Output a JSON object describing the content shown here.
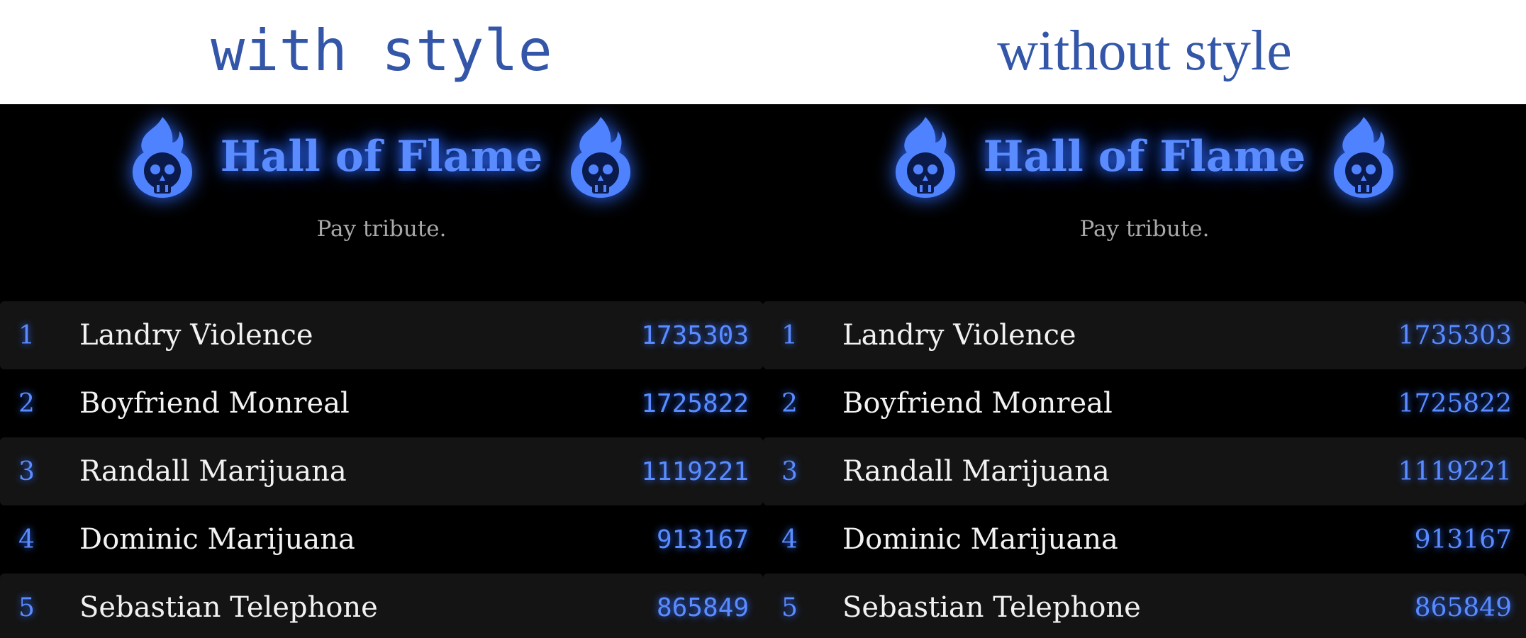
{
  "headings": {
    "left": "with style",
    "right": "without style"
  },
  "banner": {
    "title": "Hall of Flame",
    "tagline": "Pay tribute."
  },
  "icons": {
    "banner_icon": "flaming-skull-icon"
  },
  "colors": {
    "accent": "#5a8cff",
    "glow": "#2f6bff",
    "background": "#000000",
    "row_alt": "#141414",
    "heading": "#3356a8"
  },
  "leaderboard": [
    {
      "rank": "1",
      "name": "Landry Violence",
      "score": "1735303"
    },
    {
      "rank": "2",
      "name": "Boyfriend Monreal",
      "score": "1725822"
    },
    {
      "rank": "3",
      "name": "Randall Marijuana",
      "score": "1119221"
    },
    {
      "rank": "4",
      "name": "Dominic Marijuana",
      "score": "913167"
    },
    {
      "rank": "5",
      "name": "Sebastian Telephone",
      "score": "865849"
    }
  ]
}
